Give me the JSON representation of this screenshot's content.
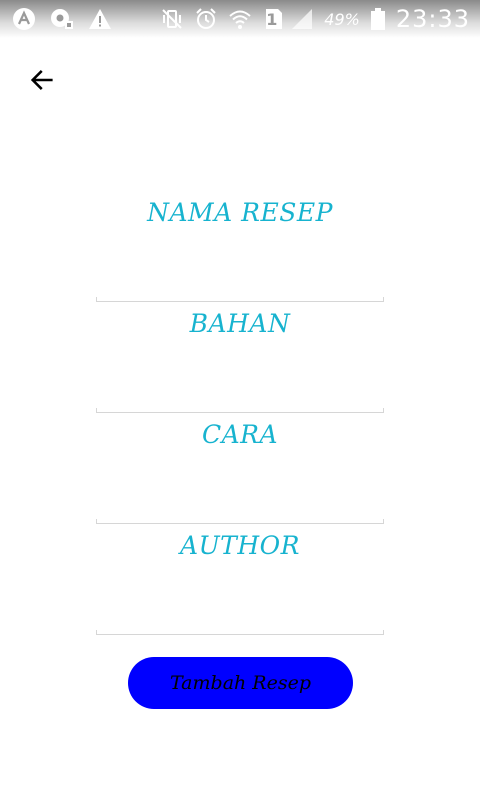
{
  "status_bar": {
    "battery_percent": "49%",
    "time": "23:33",
    "sim_slot": "1",
    "icons": [
      "app-a-icon",
      "cast-icon",
      "warning-icon",
      "vibrate-icon",
      "alarm-icon",
      "wifi-icon",
      "sim-icon",
      "signal-icon",
      "battery-icon"
    ]
  },
  "toolbar": {
    "back_icon": "arrow-left-icon"
  },
  "form": {
    "fields": [
      {
        "label": "NAMA RESEP",
        "value": "",
        "placeholder": ""
      },
      {
        "label": "BAHAN",
        "value": "",
        "placeholder": ""
      },
      {
        "label": "CARA",
        "value": "",
        "placeholder": ""
      },
      {
        "label": "AUTHOR",
        "value": "",
        "placeholder": ""
      }
    ],
    "submit_label": "Tambah Resep"
  },
  "colors": {
    "label": "#17b3cf",
    "button": "#0000ff",
    "button_text": "#000000"
  }
}
